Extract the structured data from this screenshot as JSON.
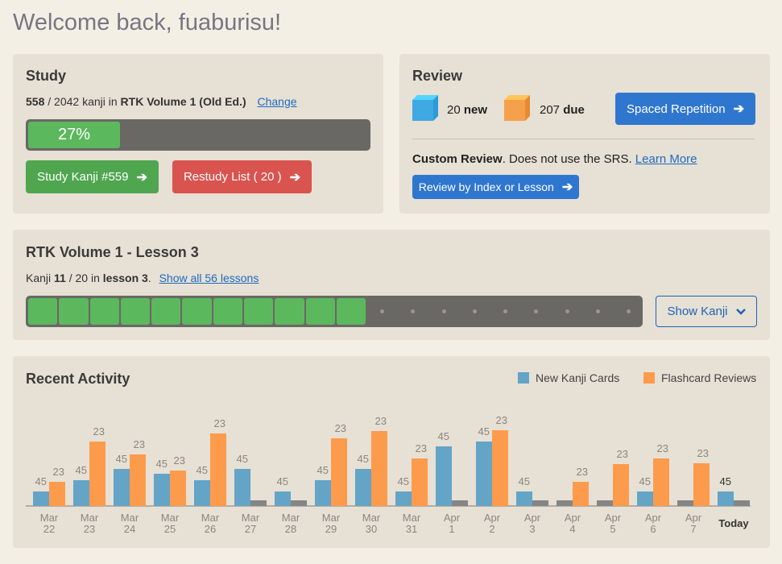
{
  "welcome": "Welcome back, fuaburisu!",
  "study": {
    "title": "Study",
    "learned": "558",
    "total_text": " / 2042 kanji in ",
    "book": "RTK Volume 1 (Old Ed.)",
    "change_link": "Change",
    "progress_percent": 27,
    "progress_label": "27%",
    "study_button": "Study Kanji #559",
    "restudy_button": "Restudy List ( 20 )"
  },
  "review": {
    "title": "Review",
    "new_count": "20",
    "new_label": "new",
    "due_count": "207",
    "due_label": "due",
    "srs_button": "Spaced Repetition",
    "custom_bold": "Custom Review",
    "custom_text": ". Does not use the SRS. ",
    "learn_more": "Learn More",
    "custom_button": "Review by Index or Lesson",
    "colors": {
      "new": "#3fa9e3",
      "due": "#f5a04a"
    }
  },
  "lesson": {
    "title": "RTK Volume 1 - Lesson 3",
    "prefix": "Kanji ",
    "current": "11",
    "of_text": " / 20 in ",
    "lesson_label": "lesson 3",
    "suffix": ".",
    "show_all_link": "Show all 56 lessons",
    "completed": 11,
    "total": 20,
    "show_kanji_button": "Show Kanji"
  },
  "activity": {
    "title": "Recent Activity"
  },
  "chart_data": {
    "type": "bar",
    "title": "Recent Activity",
    "legend": [
      "New Kanji Cards",
      "Flashcard Reviews"
    ],
    "legend_position": "top-right",
    "colors": {
      "New Kanji Cards": "#64a4c7",
      "Flashcard Reviews": "#fd9b4c",
      "zero": "#858585"
    },
    "categories": [
      [
        "Mar",
        "22"
      ],
      [
        "Mar",
        "23"
      ],
      [
        "Mar",
        "24"
      ],
      [
        "Mar",
        "25"
      ],
      [
        "Mar",
        "26"
      ],
      [
        "Mar",
        "27"
      ],
      [
        "Mar",
        "28"
      ],
      [
        "Mar",
        "29"
      ],
      [
        "Mar",
        "30"
      ],
      [
        "Mar",
        "31"
      ],
      [
        "Apr",
        "1"
      ],
      [
        "Apr",
        "2"
      ],
      [
        "Apr",
        "3"
      ],
      [
        "Apr",
        "4"
      ],
      [
        "Apr",
        "5"
      ],
      [
        "Apr",
        "6"
      ],
      [
        "Apr",
        "7"
      ],
      [
        "Today",
        ""
      ]
    ],
    "series": [
      {
        "name": "New Kanji Cards",
        "values_estimated": [
          18,
          32,
          46,
          40,
          32,
          46,
          18,
          32,
          46,
          18,
          74,
          80,
          18,
          0,
          0,
          18,
          0,
          18
        ],
        "labels": [
          "45",
          "45",
          "45",
          "45",
          "45",
          "45",
          "45",
          "45",
          "45",
          "45",
          "45",
          "45",
          "45",
          "",
          "",
          "45",
          "",
          "45"
        ]
      },
      {
        "name": "Flashcard Reviews",
        "values_estimated": [
          30,
          80,
          64,
          44,
          90,
          0,
          0,
          84,
          93,
          59,
          0,
          94,
          0,
          30,
          52,
          59,
          53,
          0
        ],
        "labels": [
          "23",
          "23",
          "23",
          "23",
          "23",
          "",
          "",
          "23",
          "23",
          "23",
          "",
          "23",
          "",
          "23",
          "23",
          "23",
          "23",
          ""
        ]
      }
    ],
    "ylim": [
      0,
      100
    ],
    "grid": false
  }
}
